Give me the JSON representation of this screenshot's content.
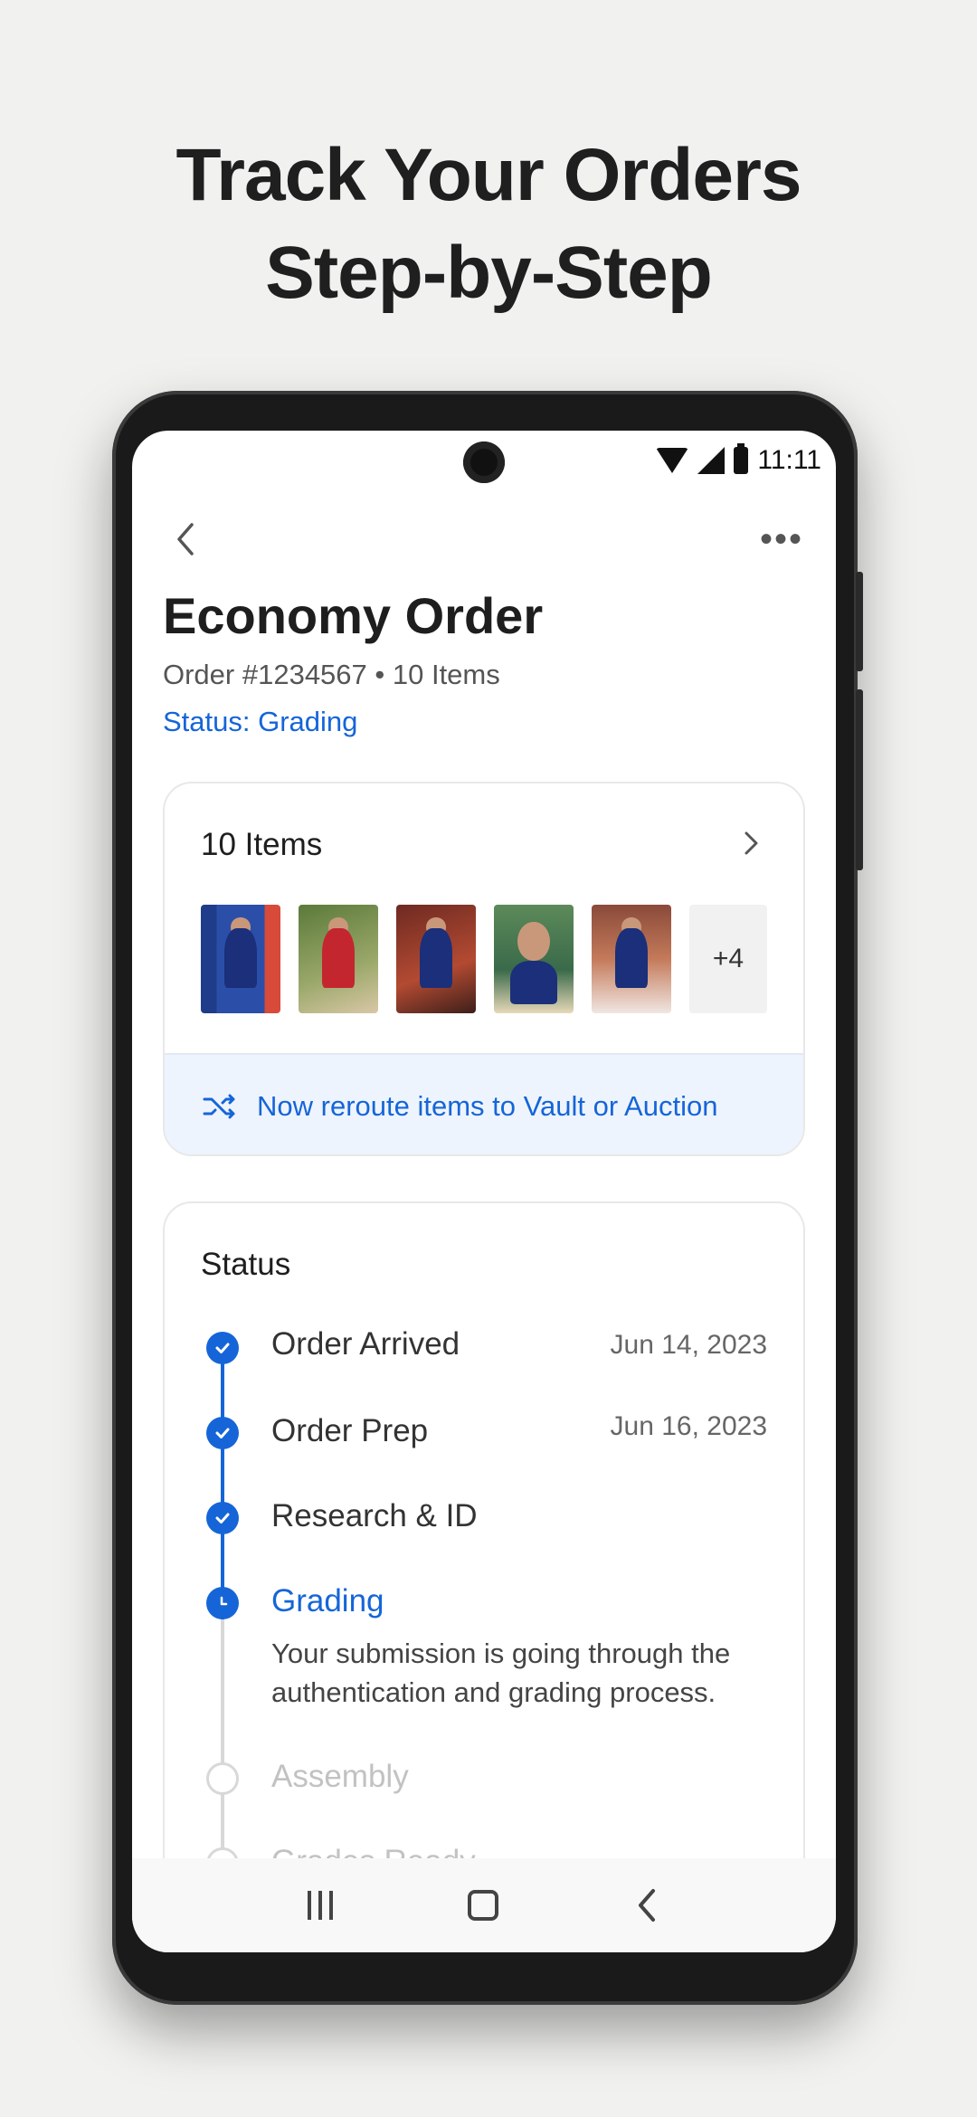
{
  "headline": {
    "line1": "Track Your Orders",
    "line2": "Step-by-Step"
  },
  "statusbar": {
    "time": "11:11"
  },
  "order": {
    "title": "Economy Order",
    "subtitle": "Order #1234567 • 10 Items",
    "status": "Status: Grading"
  },
  "items_card": {
    "heading": "10 Items",
    "more_count": "+4",
    "reroute_label": "Now reroute items to Vault or Auction"
  },
  "status_card": {
    "heading": "Status",
    "steps": [
      {
        "label": "Order Arrived",
        "date": "Jun 14, 2023"
      },
      {
        "label": "Order Prep",
        "date": "Jun 16, 2023"
      },
      {
        "label": "Research & ID",
        "date": ""
      },
      {
        "label": "Grading",
        "date": "",
        "description": "Your submission is going through the authentication and grading process."
      },
      {
        "label": "Assembly",
        "date": ""
      },
      {
        "label": "Grades Ready",
        "date": ""
      }
    ]
  },
  "colors": {
    "accent": "#1565d8",
    "reroute_bg": "#eef4fd"
  }
}
